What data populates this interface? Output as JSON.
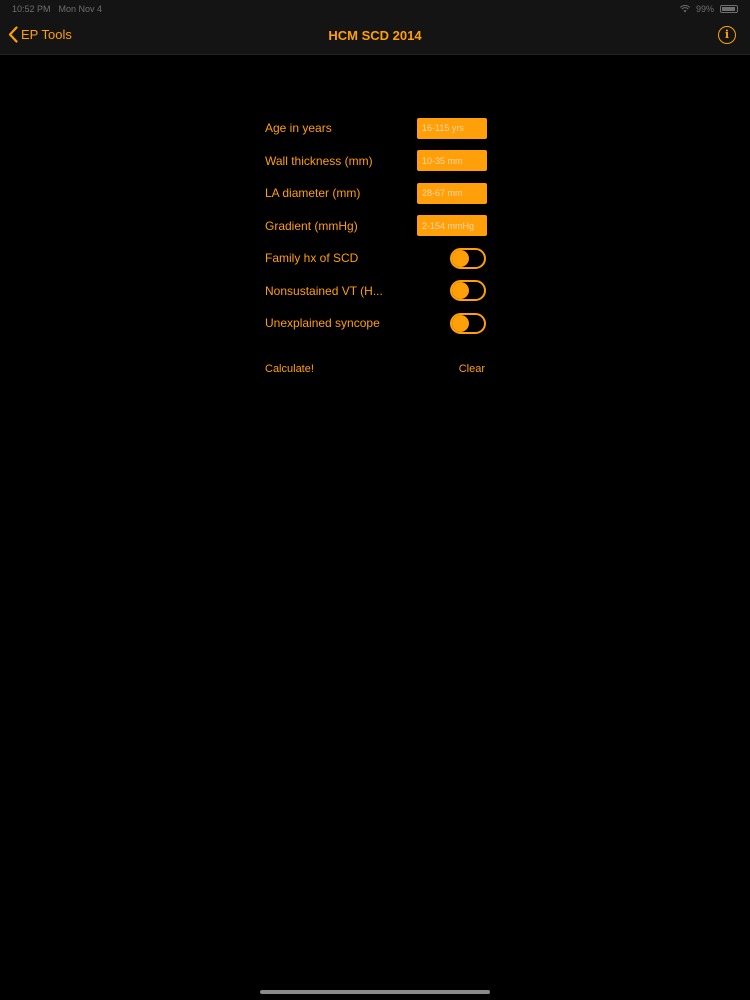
{
  "status_bar": {
    "time": "10:52 PM",
    "date": "Mon Nov 4",
    "battery": "99%"
  },
  "nav": {
    "back_label": "EP Tools",
    "title": "HCM SCD 2014"
  },
  "form": {
    "fields": [
      {
        "label": "Age in years",
        "placeholder": "16-115 yrs"
      },
      {
        "label": "Wall thickness (mm)",
        "placeholder": "10-35 mm"
      },
      {
        "label": "LA diameter (mm)",
        "placeholder": "28-67 mm"
      },
      {
        "label": "Gradient (mmHg)",
        "placeholder": "2-154 mmHg"
      }
    ],
    "toggles": [
      {
        "label": "Family hx of SCD",
        "on": true
      },
      {
        "label": "Nonsustained VT (H...",
        "on": true
      },
      {
        "label": "Unexplained syncope",
        "on": true
      }
    ]
  },
  "actions": {
    "calculate": "Calculate!",
    "clear": "Clear"
  },
  "colors": {
    "accent": "#ff9f0a",
    "background": "#000000",
    "bar": "#141414"
  }
}
